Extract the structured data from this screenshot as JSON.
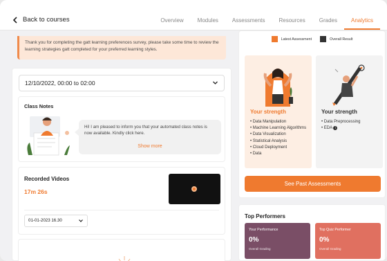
{
  "header": {
    "back_label": "Back to courses",
    "tabs": [
      {
        "label": "Overview",
        "active": false
      },
      {
        "label": "Modules",
        "active": false
      },
      {
        "label": "Assessments",
        "active": false
      },
      {
        "label": "Resources",
        "active": false
      },
      {
        "label": "Grades",
        "active": false
      },
      {
        "label": "Analytics",
        "active": true
      }
    ]
  },
  "notice": {
    "text": "Thank you for completing the gatt learning preferences survey, please take some time to review the learning strategies gatt completed for your preferred learning styles."
  },
  "session": {
    "date_range": "12/10/2022, 00:00 to 02:00"
  },
  "class_notes": {
    "title": "Class Notes",
    "message": "Hi! I am pleased to inform you that your automated class notes is now available. Kindly click here.",
    "show_more": "Show more"
  },
  "recorded_videos": {
    "title": "Recorded Videos",
    "duration": "17m 26s",
    "date_option": "01-01-2023 16.30"
  },
  "analytics": {
    "legend": [
      {
        "label": "Latest Assessment",
        "color": "#ef7a2f"
      },
      {
        "label": "Overall Result",
        "color": "#333333"
      }
    ],
    "latest_strength": {
      "title": "Your strength",
      "items": [
        "Data Manipulation",
        "Machine Learning Algorithms",
        "Data Visualization",
        "Statistical Analysis",
        "Cloud Deployment",
        "Data"
      ]
    },
    "overall_strength": {
      "title": "Your strength",
      "items": [
        "Data Preprocessing",
        "EDA"
      ]
    },
    "past_button": "See Past Assessments"
  },
  "top_performers": {
    "title": "Top Performers",
    "your_performance": {
      "label": "Your Performance",
      "value": "0%",
      "sub": "Overall Grading",
      "color": "#7a4e66"
    },
    "top_quiz": {
      "label": "Top Quiz Performer",
      "value": "0%",
      "sub": "Overall Grading",
      "color": "#e07060"
    }
  },
  "colors": {
    "accent": "#ef7a2f"
  }
}
